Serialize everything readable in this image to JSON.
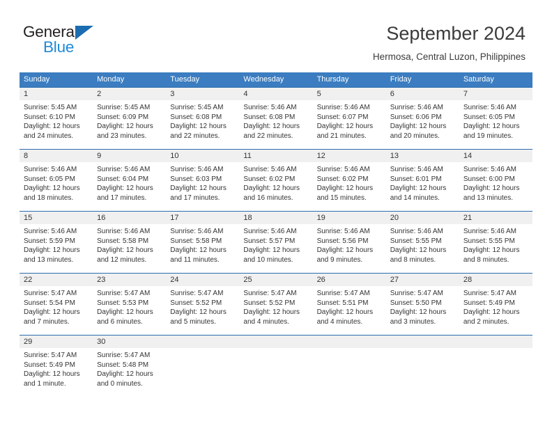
{
  "brand": {
    "line1": "General",
    "line2": "Blue",
    "triangle_icon": "brand-triangle-icon",
    "accent_dark": "#1b6cb0",
    "accent_light": "#1f8ad6"
  },
  "header": {
    "title": "September 2024",
    "subtitle": "Hermosa, Central Luzon, Philippines"
  },
  "colors": {
    "weekday_header_bg": "#3b7dc0",
    "week_divider": "#2b6cad",
    "day_number_bg": "#f0f0f0",
    "text": "#333333"
  },
  "weekdays": [
    "Sunday",
    "Monday",
    "Tuesday",
    "Wednesday",
    "Thursday",
    "Friday",
    "Saturday"
  ],
  "weeks": [
    [
      {
        "day": "1",
        "sunrise": "Sunrise: 5:45 AM",
        "sunset": "Sunset: 6:10 PM",
        "daylight1": "Daylight: 12 hours",
        "daylight2": "and 24 minutes."
      },
      {
        "day": "2",
        "sunrise": "Sunrise: 5:45 AM",
        "sunset": "Sunset: 6:09 PM",
        "daylight1": "Daylight: 12 hours",
        "daylight2": "and 23 minutes."
      },
      {
        "day": "3",
        "sunrise": "Sunrise: 5:45 AM",
        "sunset": "Sunset: 6:08 PM",
        "daylight1": "Daylight: 12 hours",
        "daylight2": "and 22 minutes."
      },
      {
        "day": "4",
        "sunrise": "Sunrise: 5:46 AM",
        "sunset": "Sunset: 6:08 PM",
        "daylight1": "Daylight: 12 hours",
        "daylight2": "and 22 minutes."
      },
      {
        "day": "5",
        "sunrise": "Sunrise: 5:46 AM",
        "sunset": "Sunset: 6:07 PM",
        "daylight1": "Daylight: 12 hours",
        "daylight2": "and 21 minutes."
      },
      {
        "day": "6",
        "sunrise": "Sunrise: 5:46 AM",
        "sunset": "Sunset: 6:06 PM",
        "daylight1": "Daylight: 12 hours",
        "daylight2": "and 20 minutes."
      },
      {
        "day": "7",
        "sunrise": "Sunrise: 5:46 AM",
        "sunset": "Sunset: 6:05 PM",
        "daylight1": "Daylight: 12 hours",
        "daylight2": "and 19 minutes."
      }
    ],
    [
      {
        "day": "8",
        "sunrise": "Sunrise: 5:46 AM",
        "sunset": "Sunset: 6:05 PM",
        "daylight1": "Daylight: 12 hours",
        "daylight2": "and 18 minutes."
      },
      {
        "day": "9",
        "sunrise": "Sunrise: 5:46 AM",
        "sunset": "Sunset: 6:04 PM",
        "daylight1": "Daylight: 12 hours",
        "daylight2": "and 17 minutes."
      },
      {
        "day": "10",
        "sunrise": "Sunrise: 5:46 AM",
        "sunset": "Sunset: 6:03 PM",
        "daylight1": "Daylight: 12 hours",
        "daylight2": "and 17 minutes."
      },
      {
        "day": "11",
        "sunrise": "Sunrise: 5:46 AM",
        "sunset": "Sunset: 6:02 PM",
        "daylight1": "Daylight: 12 hours",
        "daylight2": "and 16 minutes."
      },
      {
        "day": "12",
        "sunrise": "Sunrise: 5:46 AM",
        "sunset": "Sunset: 6:02 PM",
        "daylight1": "Daylight: 12 hours",
        "daylight2": "and 15 minutes."
      },
      {
        "day": "13",
        "sunrise": "Sunrise: 5:46 AM",
        "sunset": "Sunset: 6:01 PM",
        "daylight1": "Daylight: 12 hours",
        "daylight2": "and 14 minutes."
      },
      {
        "day": "14",
        "sunrise": "Sunrise: 5:46 AM",
        "sunset": "Sunset: 6:00 PM",
        "daylight1": "Daylight: 12 hours",
        "daylight2": "and 13 minutes."
      }
    ],
    [
      {
        "day": "15",
        "sunrise": "Sunrise: 5:46 AM",
        "sunset": "Sunset: 5:59 PM",
        "daylight1": "Daylight: 12 hours",
        "daylight2": "and 13 minutes."
      },
      {
        "day": "16",
        "sunrise": "Sunrise: 5:46 AM",
        "sunset": "Sunset: 5:58 PM",
        "daylight1": "Daylight: 12 hours",
        "daylight2": "and 12 minutes."
      },
      {
        "day": "17",
        "sunrise": "Sunrise: 5:46 AM",
        "sunset": "Sunset: 5:58 PM",
        "daylight1": "Daylight: 12 hours",
        "daylight2": "and 11 minutes."
      },
      {
        "day": "18",
        "sunrise": "Sunrise: 5:46 AM",
        "sunset": "Sunset: 5:57 PM",
        "daylight1": "Daylight: 12 hours",
        "daylight2": "and 10 minutes."
      },
      {
        "day": "19",
        "sunrise": "Sunrise: 5:46 AM",
        "sunset": "Sunset: 5:56 PM",
        "daylight1": "Daylight: 12 hours",
        "daylight2": "and 9 minutes."
      },
      {
        "day": "20",
        "sunrise": "Sunrise: 5:46 AM",
        "sunset": "Sunset: 5:55 PM",
        "daylight1": "Daylight: 12 hours",
        "daylight2": "and 8 minutes."
      },
      {
        "day": "21",
        "sunrise": "Sunrise: 5:46 AM",
        "sunset": "Sunset: 5:55 PM",
        "daylight1": "Daylight: 12 hours",
        "daylight2": "and 8 minutes."
      }
    ],
    [
      {
        "day": "22",
        "sunrise": "Sunrise: 5:47 AM",
        "sunset": "Sunset: 5:54 PM",
        "daylight1": "Daylight: 12 hours",
        "daylight2": "and 7 minutes."
      },
      {
        "day": "23",
        "sunrise": "Sunrise: 5:47 AM",
        "sunset": "Sunset: 5:53 PM",
        "daylight1": "Daylight: 12 hours",
        "daylight2": "and 6 minutes."
      },
      {
        "day": "24",
        "sunrise": "Sunrise: 5:47 AM",
        "sunset": "Sunset: 5:52 PM",
        "daylight1": "Daylight: 12 hours",
        "daylight2": "and 5 minutes."
      },
      {
        "day": "25",
        "sunrise": "Sunrise: 5:47 AM",
        "sunset": "Sunset: 5:52 PM",
        "daylight1": "Daylight: 12 hours",
        "daylight2": "and 4 minutes."
      },
      {
        "day": "26",
        "sunrise": "Sunrise: 5:47 AM",
        "sunset": "Sunset: 5:51 PM",
        "daylight1": "Daylight: 12 hours",
        "daylight2": "and 4 minutes."
      },
      {
        "day": "27",
        "sunrise": "Sunrise: 5:47 AM",
        "sunset": "Sunset: 5:50 PM",
        "daylight1": "Daylight: 12 hours",
        "daylight2": "and 3 minutes."
      },
      {
        "day": "28",
        "sunrise": "Sunrise: 5:47 AM",
        "sunset": "Sunset: 5:49 PM",
        "daylight1": "Daylight: 12 hours",
        "daylight2": "and 2 minutes."
      }
    ],
    [
      {
        "day": "29",
        "sunrise": "Sunrise: 5:47 AM",
        "sunset": "Sunset: 5:49 PM",
        "daylight1": "Daylight: 12 hours",
        "daylight2": "and 1 minute."
      },
      {
        "day": "30",
        "sunrise": "Sunrise: 5:47 AM",
        "sunset": "Sunset: 5:48 PM",
        "daylight1": "Daylight: 12 hours",
        "daylight2": "and 0 minutes."
      },
      {
        "day": "",
        "sunrise": "",
        "sunset": "",
        "daylight1": "",
        "daylight2": ""
      },
      {
        "day": "",
        "sunrise": "",
        "sunset": "",
        "daylight1": "",
        "daylight2": ""
      },
      {
        "day": "",
        "sunrise": "",
        "sunset": "",
        "daylight1": "",
        "daylight2": ""
      },
      {
        "day": "",
        "sunrise": "",
        "sunset": "",
        "daylight1": "",
        "daylight2": ""
      },
      {
        "day": "",
        "sunrise": "",
        "sunset": "",
        "daylight1": "",
        "daylight2": ""
      }
    ]
  ]
}
